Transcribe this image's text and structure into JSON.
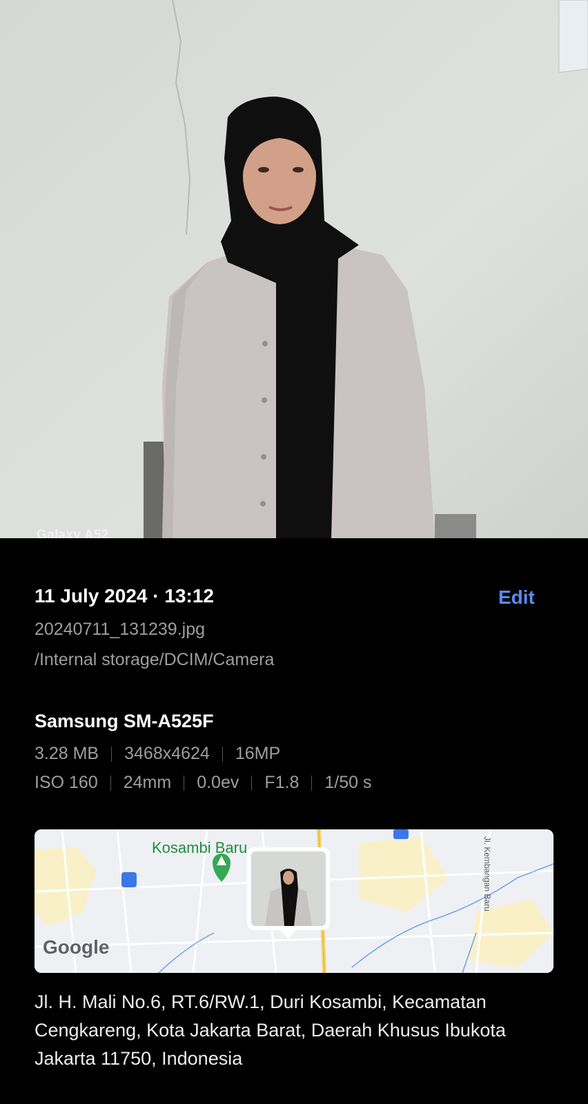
{
  "photo": {
    "watermark": "Galaxy A52",
    "description_icon": "portrait-photo"
  },
  "details": {
    "date_time": "11 July 2024 · 13:12",
    "edit_label": "Edit",
    "filename": "20240711_131239.jpg",
    "path": "/Internal storage/DCIM/Camera",
    "device": "Samsung SM-A525F",
    "row1": [
      "3.28 MB",
      "3468x4624",
      "16MP"
    ],
    "row2": [
      "ISO 160",
      "24mm",
      "0.0ev",
      "F1.8",
      "1/50 s"
    ]
  },
  "map": {
    "place_label": "Kosambi Baru",
    "road_label": "Jl. Kembangan Baru",
    "logo": "Google",
    "colors": {
      "road_major": "#f5d76e",
      "water": "#4a8fe7",
      "park_pin": "#34a853"
    }
  },
  "address": "Jl. H. Mali No.6, RT.6/RW.1, Duri Kosambi, Kecamatan Cengkareng, Kota Jakarta Barat, Daerah Khusus Ibukota Jakarta 11750, Indonesia"
}
